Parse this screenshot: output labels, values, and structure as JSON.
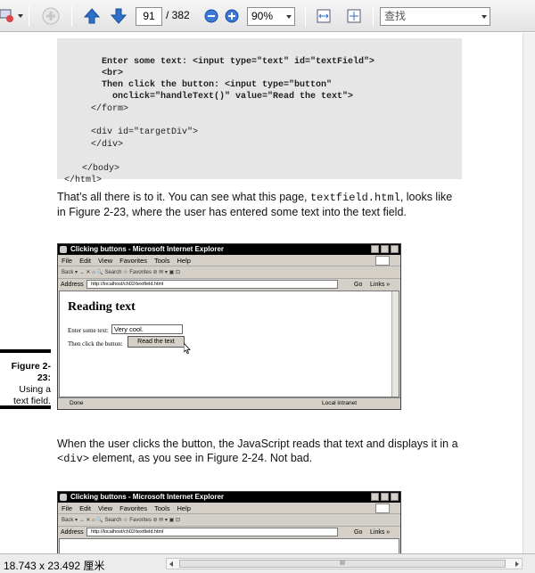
{
  "toolbar": {
    "page_current": "91",
    "page_total": "/ 382",
    "zoom": "90%",
    "search_placeholder": "查找"
  },
  "code": {
    "lines_bold": [
      "Enter some text: <input type=\"text\" id=\"textField\">",
      "<br>",
      "Then click the button: <input type=\"button\"",
      "  onclick=\"handleText()\" value=\"Read the text\">"
    ],
    "lines_plain": [
      "</form>",
      "",
      "<div id=\"targetDiv\">",
      "</div>",
      "",
      "</body>",
      "</html>"
    ]
  },
  "para1": {
    "before": "That’s all there is to it. You can see what this page, ",
    "code": "textfield.html",
    "after": ", looks like in Figure 2-23, where the user has entered some text into the text field."
  },
  "para2": {
    "before": "When the user clicks the button, the JavaScript reads that text and displays it in a ",
    "code": "<div>",
    "after": " element, as you see in Figure 2-24. Not bad."
  },
  "figure1": {
    "caption_title": "Figure 2-23:",
    "caption_text": "Using a text field.",
    "window_title": "Clicking buttons - Microsoft Internet Explorer",
    "menu": [
      "File",
      "Edit",
      "View",
      "Favorites",
      "Tools",
      "Help"
    ],
    "tools_text": "Back ▾  →  ✕  ⌂  🔍 Search   ☆ Favorites   ⊘   ✉ ▾   ▣   ⊡",
    "address_label": "Address",
    "address_url": "http://localhost/ch02/textfield.html",
    "go_label": "Go",
    "links_label": "Links »",
    "heading": "Reading text",
    "field_label": "Enter some text:",
    "field_value": "Very cool.",
    "button_label": "Then click the button:",
    "button_value": "Read the text",
    "status_left": "Done",
    "status_right": "Local intranet"
  },
  "figure2": {
    "window_title": "Clicking buttons - Microsoft Internet Explorer",
    "menu": [
      "File",
      "Edit",
      "View",
      "Favorites",
      "Tools",
      "Help"
    ],
    "tools_text": "Back ▾  →  ✕  ⌂  🔍 Search   ☆ Favorites   ⊘   ✉ ▾   ▣   ⊡",
    "address_label": "Address",
    "address_url": "http://localhost/ch02/textfield.html",
    "go_label": "Go",
    "links_label": "Links »"
  },
  "status": {
    "page_size": "18.743 x 23.492 厘米",
    "scroll_marker": "III"
  }
}
